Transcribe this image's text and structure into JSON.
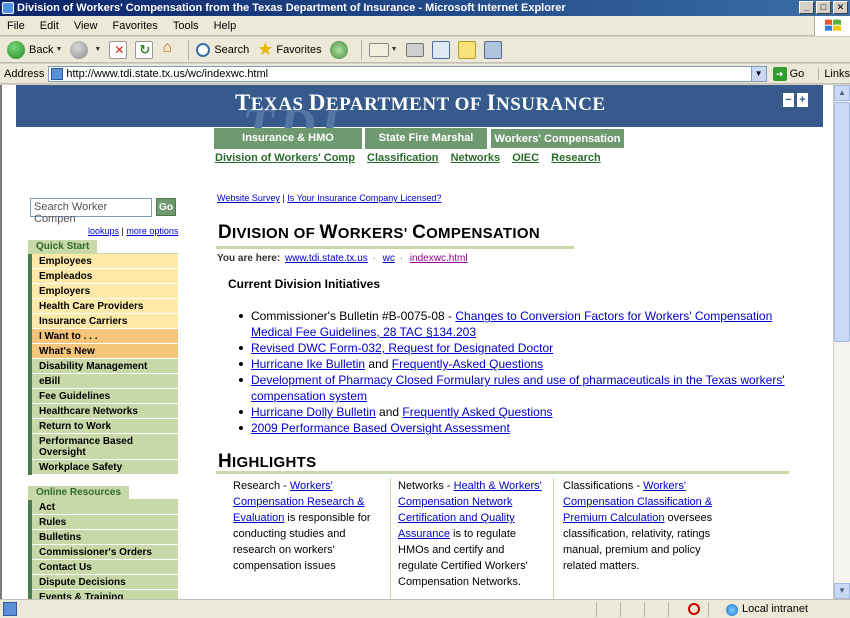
{
  "window": {
    "title": "Division of Workers' Compensation from the Texas Department of Insurance - Microsoft Internet Explorer",
    "buttons": [
      "_",
      "□",
      "✕"
    ]
  },
  "menu": [
    "File",
    "Edit",
    "View",
    "Favorites",
    "Tools",
    "Help"
  ],
  "toolbar": {
    "back": "Back",
    "search": "Search",
    "favorites": "Favorites"
  },
  "address": {
    "label": "Address",
    "url": "http://www.tdi.state.tx.us/wc/indexwc.html",
    "go": "Go",
    "links": "Links"
  },
  "status": {
    "zone": "Local intranet"
  },
  "page": {
    "banner_title": {
      "t1": "T",
      "w1": "EXAS ",
      "t2": "D",
      "w2": "EPARTMENT OF ",
      "t3": "I",
      "w3": "NSURANCE"
    },
    "banner_watermark": "TDI",
    "font_size_buttons": [
      "−",
      "+"
    ],
    "tabs": [
      "Insurance & HMO",
      "State Fire Marshal",
      "Workers' Compensation"
    ],
    "subnav": [
      "Division of Workers' Comp",
      "Classification",
      "Networks",
      "OIEC",
      "Research"
    ],
    "search": {
      "value": "Search Worker Compen",
      "go": "Go",
      "lookups": "lookups",
      "sep": "|",
      "more_options": "more options"
    },
    "quick_start": {
      "heading": "Quick Start",
      "items": [
        {
          "label": "Employees",
          "style": "yellow"
        },
        {
          "label": "Empleados",
          "style": "yellow"
        },
        {
          "label": "Employers",
          "style": "yellow"
        },
        {
          "label": "Health Care Providers",
          "style": "yellow"
        },
        {
          "label": "Insurance Carriers",
          "style": "yellow"
        },
        {
          "label": "I Want to . . .",
          "style": "orange"
        },
        {
          "label": "What's New",
          "style": "orange"
        },
        {
          "label": "Disability Management",
          "style": "green"
        },
        {
          "label": "eBill",
          "style": "green"
        },
        {
          "label": "Fee Guidelines",
          "style": "green"
        },
        {
          "label": "Healthcare Networks",
          "style": "green"
        },
        {
          "label": "Return to Work",
          "style": "green"
        },
        {
          "label": "Performance Based Oversight",
          "style": "green"
        },
        {
          "label": "Workplace Safety",
          "style": "green"
        }
      ]
    },
    "online_resources": {
      "heading": "Online Resources",
      "items": [
        "Act",
        "Rules",
        "Bulletins",
        "Commissioner's Orders",
        "Contact Us",
        "Dispute Decisions",
        "Events & Training"
      ]
    },
    "top_links": {
      "survey": "Website Survey",
      "sep": "|",
      "licensed": "Is Your Insurance Company Licensed?"
    },
    "title": {
      "c1": "D",
      "w1": "IVISION OF ",
      "c2": "W",
      "w2": "ORKERS' ",
      "c3": "C",
      "w3": "OMPENSATION"
    },
    "breadcrumb": {
      "label": "You are here:",
      "items": [
        "www.tdi.state.tx.us",
        "wc",
        "indexwc.html"
      ],
      "sep": "·"
    },
    "initiatives_heading": "Current Division Initiatives",
    "initiatives": [
      {
        "pre": "Commissioner's Bulletin #B-0075-08 - ",
        "link": "Changes to Conversion Factors for Workers' Compensation Medical Fee Guidelines, 28 TAC §134.203",
        "mid": "",
        "link2": ""
      },
      {
        "pre": "",
        "link": "Revised DWC Form-032, Request for Designated Doctor",
        "mid": "",
        "link2": ""
      },
      {
        "pre": "",
        "link": "Hurricane Ike Bulletin",
        "mid": " and ",
        "link2": "Frequently-Asked Questions"
      },
      {
        "pre": "",
        "link": "Development of Pharmacy Closed Formulary rules and use of pharmaceuticals in the Texas workers' compensation system",
        "mid": "",
        "link2": ""
      },
      {
        "pre": "",
        "link": "Hurricane Dolly Bulletin",
        "mid": " and ",
        "link2": "Frequently Asked Questions"
      },
      {
        "pre": "",
        "link": "2009 Performance Based Oversight Assessment",
        "mid": "",
        "link2": ""
      }
    ],
    "highlights": {
      "c1": "H",
      "w1": "IGHLIGHTS",
      "columns": [
        {
          "pre": "Research - ",
          "link": "Workers' Compensation Research & Evaluation",
          "post": " is responsible for conducting studies and research on workers' compensation issues"
        },
        {
          "pre": "Networks - ",
          "link": "Health & Workers' Compensation Network Certification and Quality Assurance",
          "post": " is to regulate HMOs and certify and regulate Certified Workers' Compensation Networks."
        },
        {
          "pre": "Classifications - ",
          "link": "Workers' Compensation Classification & Premium Calculation",
          "post": " oversees classification, relativity, ratings manual, premium and policy related matters."
        }
      ]
    }
  }
}
